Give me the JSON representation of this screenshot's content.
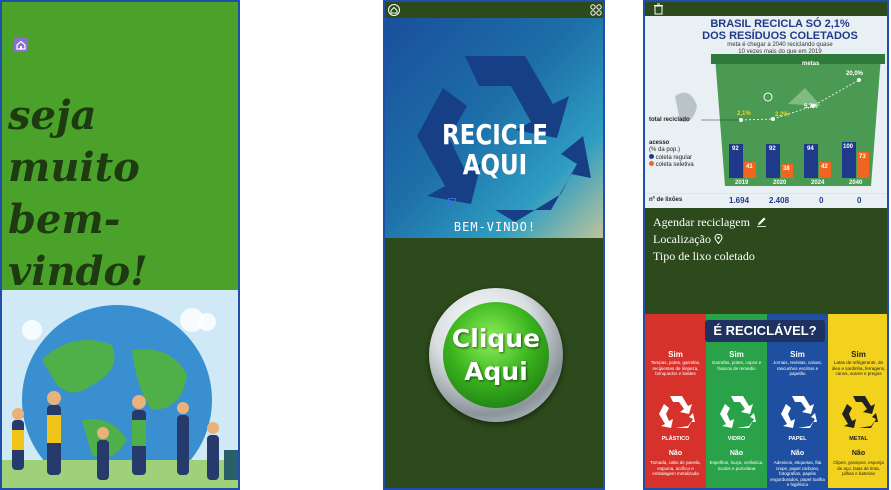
{
  "screen1": {
    "welcome_line1": "seja muito",
    "welcome_line2": "bem-vindo!",
    "home_icon": "home-icon"
  },
  "screen2": {
    "recicle_line1": "RECICLE",
    "recicle_line2": "AQUI",
    "bem_vindo": "BEM-VINDO!",
    "button_line1": "Clique",
    "button_line2": "Aqui",
    "home_icon": "home-icon",
    "grid_icon": "grid-icon"
  },
  "screen3": {
    "infographic": {
      "title_line1": "BRASIL RECICLA SÓ 2,1%",
      "title_line2": "DOS RESÍDUOS COLETADOS",
      "subtitle_line1": "meta é chegar a 2040 reciclando quase",
      "subtitle_line2": "10 vezes mais do que em 2019",
      "metas_label": "metas",
      "total_label": "total reciclado",
      "acesso_label": "acesso",
      "pop_label": "(% da pop.)",
      "legend_regular": "coleta regular",
      "legend_seletiva": "coleta seletiva",
      "lixoes_label": "nº de lixões",
      "years": [
        "2019",
        "2020",
        "2024",
        "2040"
      ],
      "percent": [
        "2,1%",
        "2,2%",
        "5,7%",
        "20,0%"
      ],
      "regular": [
        "92",
        "92",
        "94",
        "100"
      ],
      "seletiva": [
        "41",
        "38",
        "42",
        "73"
      ],
      "lixoes": [
        "1.694",
        "2.408",
        "0",
        "0"
      ]
    },
    "menu": {
      "agendar": "Agendar reciclagem",
      "localizacao": "Localização",
      "tipo": "Tipo de lixo coletado"
    },
    "poster": {
      "title": "É RECICLÁVEL?",
      "sim": "Sim",
      "nao": "Não",
      "columns": [
        {
          "name": "PLÁSTICO",
          "color": "#d6312b",
          "sim_text": "Tampas, potes, garrafas, recipientes de limpeza, brinquedos e baldes",
          "nao_text": "Tomada, cabo de panela, espuma, acrílico e embalagem metalizada"
        },
        {
          "name": "VIDRO",
          "color": "#2aa24a",
          "sim_text": "Garrafas, potes, copos e frascos de remédio",
          "nao_text": "Espelhos, louça, cerâmica, óculos e porcelana"
        },
        {
          "name": "PAPEL",
          "color": "#1e4fa0",
          "sim_text": "Jornais, revistas, caixas, rascunhos escritos e papelão",
          "nao_text": "Adesivos, etiquetas, fita crepe, papel carbono, fotografias, papéis engordurados, papel toalha e higiênico"
        },
        {
          "name": "METAL",
          "color": "#f2d21c",
          "sim_text": "Latas de refrigerante, de óleo e sardinha, ferragens, canos, arame e pregos",
          "nao_text": "Clipes, grampos, esponja de aço, latas de tinta, pilhas e baterias"
        }
      ]
    }
  }
}
